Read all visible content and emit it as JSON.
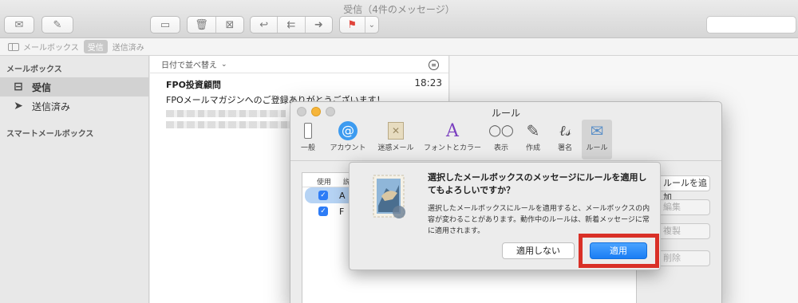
{
  "window": {
    "title": "受信（4件のメッセージ）"
  },
  "toolbar": {
    "buttons": [
      {
        "icon": "envelope-icon",
        "glyph": "✉"
      },
      {
        "icon": "compose-icon",
        "glyph": "✎"
      },
      {
        "icon": "archive-icon",
        "glyph": "▭"
      },
      {
        "icon": "trash-icon",
        "glyph": "🗑"
      },
      {
        "icon": "junk-icon",
        "glyph": "⊠"
      },
      {
        "icon": "reply-icon",
        "glyph": "↩"
      },
      {
        "icon": "reply-all-icon",
        "glyph": "⇇"
      },
      {
        "icon": "forward-icon",
        "glyph": "➜"
      },
      {
        "icon": "flag-icon",
        "glyph": "⚑"
      },
      {
        "icon": "chevron-down-icon",
        "glyph": "⌄"
      }
    ]
  },
  "favorites": {
    "mailboxes": "メールボックス",
    "inbox": "受信",
    "sent": "送信済み"
  },
  "sidebar": {
    "section_title": "メールボックス",
    "items": [
      {
        "label": "受信",
        "glyph": "⊟"
      },
      {
        "label": "送信済み",
        "glyph": "➤"
      }
    ],
    "smart_title": "スマートメールボックス"
  },
  "list": {
    "sort_label": "日付で並べ替え",
    "message": {
      "from": "FPO投資顧問",
      "time": "18:23",
      "subject": "FPOメールマガジンへのご登録ありがとうございます！"
    }
  },
  "prefs": {
    "title": "ルール",
    "tabs": [
      "一般",
      "アカウント",
      "迷惑メール",
      "フォントとカラー",
      "表示",
      "作成",
      "署名",
      "ルール"
    ],
    "table": {
      "header_use": "使用",
      "header_desc": "説",
      "rows": [
        "A",
        "F"
      ]
    },
    "side_buttons": [
      "ルールを追加",
      "編集",
      "複製",
      "削除"
    ]
  },
  "dialog": {
    "title": "選択したメールボックスのメッセージにルールを適用してもよろしいですか？",
    "body": "選択したメールボックスにルールを適用すると、メールボックスの内容が変わることがあります。動作中のルールは、新着メッセージに常に適用されます。",
    "cancel_label": "適用しない",
    "apply_label": "適用"
  }
}
